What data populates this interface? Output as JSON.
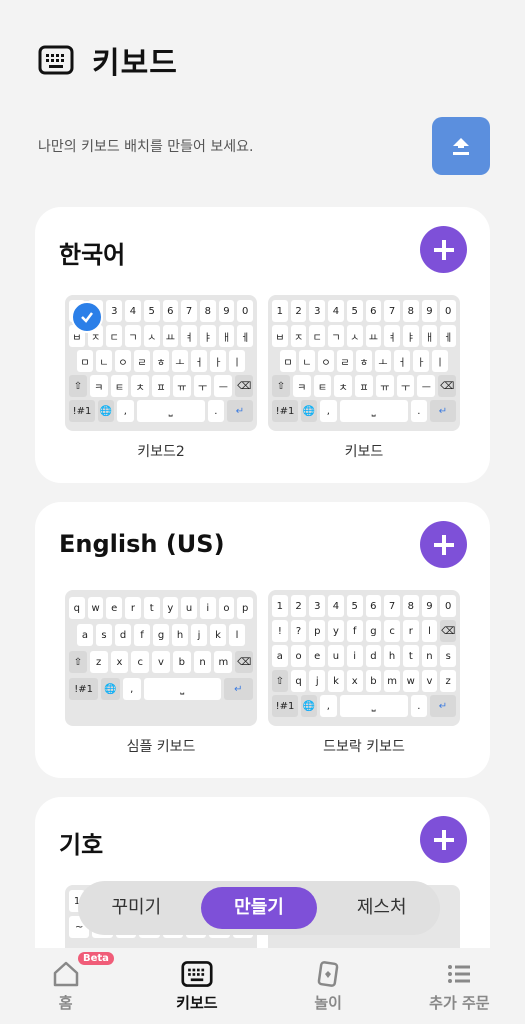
{
  "header": {
    "title": "키보드",
    "icon": "keyboard-icon"
  },
  "subtitle": "나만의 키보드 배치를 만들어 보세요.",
  "upload": {
    "icon": "upload-icon",
    "color": "#5b8fde"
  },
  "accent": "#7e50d8",
  "sections": [
    {
      "title": "한국어",
      "keyboards": [
        {
          "label": "키보드2",
          "selected": true,
          "rows": [
            [
              "1",
              "2",
              "3",
              "4",
              "5",
              "6",
              "7",
              "8",
              "9",
              "0"
            ],
            [
              "ㅂ",
              "ㅈ",
              "ㄷ",
              "ㄱ",
              "ㅅ",
              "ㅛ",
              "ㅕ",
              "ㅑ",
              "ㅐ",
              "ㅔ"
            ],
            [
              "ㅁ",
              "ㄴ",
              "ㅇ",
              "ㄹ",
              "ㅎ",
              "ㅗ",
              "ㅓ",
              "ㅏ",
              "ㅣ"
            ],
            [
              "ㅋ",
              "ㅌ",
              "ㅊ",
              "ㅍ",
              "ㅠ",
              "ㅜ",
              "ㅡ"
            ],
            [
              "!#1",
              ",",
              ".",
              "↵"
            ]
          ]
        },
        {
          "label": "키보드",
          "selected": false,
          "rows": [
            [
              "1",
              "2",
              "3",
              "4",
              "5",
              "6",
              "7",
              "8",
              "9",
              "0"
            ],
            [
              "ㅂ",
              "ㅈ",
              "ㄷ",
              "ㄱ",
              "ㅅ",
              "ㅛ",
              "ㅕ",
              "ㅑ",
              "ㅐ",
              "ㅔ"
            ],
            [
              "ㅁ",
              "ㄴ",
              "ㅇ",
              "ㄹ",
              "ㅎ",
              "ㅗ",
              "ㅓ",
              "ㅏ",
              "ㅣ"
            ],
            [
              "ㅋ",
              "ㅌ",
              "ㅊ",
              "ㅍ",
              "ㅠ",
              "ㅜ",
              "ㅡ"
            ],
            [
              "!#1",
              ",",
              ".",
              "↵"
            ]
          ]
        }
      ]
    },
    {
      "title": "English (US)",
      "keyboards": [
        {
          "label": "심플 키보드",
          "selected": false,
          "rows": [
            [
              "q",
              "w",
              "e",
              "r",
              "t",
              "y",
              "u",
              "i",
              "o",
              "p"
            ],
            [
              "a",
              "s",
              "d",
              "f",
              "g",
              "h",
              "j",
              "k",
              "l"
            ],
            [
              "z",
              "x",
              "c",
              "v",
              "b",
              "n",
              "m"
            ],
            [
              "!#1",
              ",",
              "↵"
            ]
          ]
        },
        {
          "label": "드보락 키보드",
          "selected": false,
          "rows": [
            [
              "1",
              "2",
              "3",
              "4",
              "5",
              "6",
              "7",
              "8",
              "9",
              "0"
            ],
            [
              "!",
              "?",
              "p",
              "y",
              "f",
              "g",
              "c",
              "r",
              "l"
            ],
            [
              "a",
              "o",
              "e",
              "u",
              "i",
              "d",
              "h",
              "t",
              "n",
              "s"
            ],
            [
              "q",
              "j",
              "k",
              "x",
              "b",
              "m",
              "w",
              "v",
              "z"
            ],
            [
              "!#1",
              ",",
              ".",
              "↵"
            ]
          ]
        }
      ]
    },
    {
      "title": "기호",
      "keyboards": [
        {
          "rows": [
            [
              "1"
            ],
            [
              "~",
              "/",
              "\\",
              "(",
              ")",
              "₩",
              "&",
              "@"
            ]
          ]
        }
      ]
    }
  ],
  "mode_tabs": [
    {
      "label": "꾸미기",
      "active": false
    },
    {
      "label": "만들기",
      "active": true
    },
    {
      "label": "제스처",
      "active": false
    }
  ],
  "bottom_nav": [
    {
      "label": "홈",
      "icon": "home-icon",
      "badge": "Beta",
      "active": false
    },
    {
      "label": "키보드",
      "icon": "keyboard-icon",
      "active": true
    },
    {
      "label": "놀이",
      "icon": "cards-icon",
      "active": false
    },
    {
      "label": "추가 주문",
      "icon": "menu-list-icon",
      "active": false
    }
  ]
}
